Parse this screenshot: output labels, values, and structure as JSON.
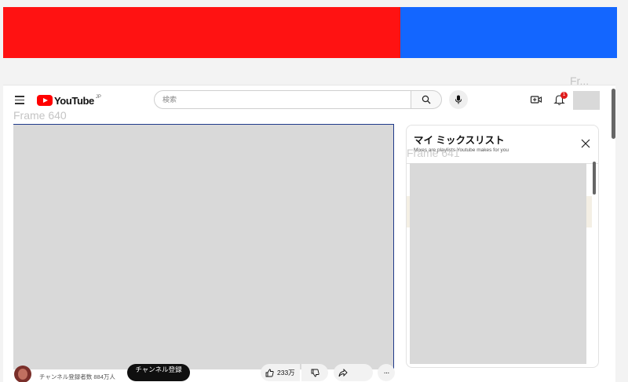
{
  "header": {
    "logo_text": "YouTube",
    "logo_region": "JP",
    "search_placeholder": "検索",
    "notification_count": "1"
  },
  "frames": {
    "frame_640_label": "Frame 640",
    "frame_641_label": "Frame 641",
    "frame_top_right_label": "Fr..."
  },
  "video": {
    "channel_subscribers": "チャンネル登録者数 884万人",
    "subscribe_label": "チャンネル登録",
    "like_count": "233万",
    "more_label": "···"
  },
  "mix_panel": {
    "title": "マイ ミックスリスト",
    "subtitle": "Mixes are playlists Youtube makes for you"
  },
  "colors": {
    "band_left": "#ff1212",
    "band_right": "#1366ff",
    "brand_red": "#ff0000",
    "badge_red": "#e01b1b"
  },
  "icons": [
    "menu-icon",
    "search-icon",
    "microphone-icon",
    "create-video-icon",
    "bell-icon",
    "close-icon",
    "thumbs-up-icon",
    "thumbs-down-icon",
    "share-icon",
    "more-icon"
  ]
}
